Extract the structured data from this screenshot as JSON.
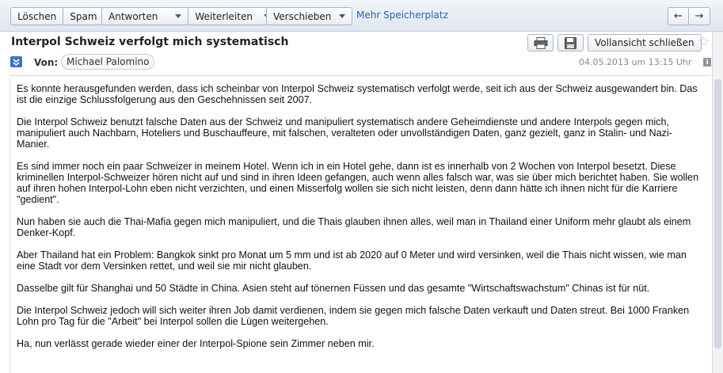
{
  "toolbar": {
    "delete_label": "Löschen",
    "spam_label": "Spam",
    "reply_label": "Antworten",
    "forward_label": "Weiterleiten",
    "move_label": "Verschieben",
    "storage_link": "Mehr Speicherplatz",
    "prev_arrow": "←",
    "next_arrow": "→"
  },
  "message": {
    "subject": "Interpol Schweiz verfolgt mich systematisch",
    "close_full_view_label": "Vollansicht schließen",
    "from_label": "Von:",
    "sender": "Michael Palomino",
    "date": "04.05.2013 um 13:15 Uhr",
    "info_glyph": "i",
    "paragraphs": [
      "Es konnte herausgefunden werden, dass ich scheinbar von Interpol Schweiz systematisch verfolgt werde, seit ich aus der Schweiz ausgewandert bin. Das ist die einzige Schlussfolgerung aus den Geschehnissen seit 2007.",
      "Die Interpol Schweiz benutzt falsche Daten aus der Schweiz und manipuliert systematisch andere Geheimdienste und andere Interpols gegen mich, manipuliert auch Nachbarn, Hoteliers und Buschauffeure, mit falschen, veralteten oder unvollständigen Daten, ganz gezielt, ganz in Stalin- und Nazi-Manier.",
      "Es sind immer noch ein paar Schweizer in meinem Hotel. Wenn ich in ein Hotel gehe, dann ist es innerhalb von 2 Wochen von Interpol besetzt. Diese kriminellen Interpol-Schweizer hören nicht auf und sind in ihren Ideen gefangen, auch wenn alles falsch war, was sie über mich berichtet haben. Sie wollen auf ihren hohen Interpol-Lohn eben nicht verzichten, und einen Misserfolg wollen sie sich nicht leisten, denn dann hätte ich ihnen nicht für die Karriere \"gedient\".",
      "Nun haben sie auch die Thai-Mafia gegen mich manipuliert, und die Thais glauben ihnen alles, weil man in Thailand einer Uniform mehr glaubt als einem Denker-Kopf.",
      "Aber Thailand hat ein Problem: Bangkok sinkt pro Monat um 5 mm und ist ab 2020 auf 0 Meter und wird versinken, weil die Thais nicht wissen, wie man eine Stadt vor dem Versinken rettet, und weil sie mir nicht glauben.",
      "Dasselbe gilt für Shanghai und 50 Städte in China. Asien steht auf tönernen Füssen und das gesamte \"Wirtschaftswachstum\" Chinas ist für nüt.",
      "Die Interpol Schweiz jedoch will sich weiter ihren Job damit verdienen, indem sie gegen mich falsche Daten verkauft und Daten streut. Bei 1000 Franken Lohn pro Tag für die \"Arbeit\" bei Interpol sollen die Lügen weitergehen.",
      "Ha, nun verlässt gerade wieder einer der Interpol-Spione sein Zimmer neben mir."
    ]
  },
  "icons": {
    "print": "print-icon",
    "save": "floppy-disk-icon",
    "star": "star-icon",
    "expand": "chevron-double-down-icon",
    "info": "info-icon"
  },
  "colors": {
    "link": "#2a62b5",
    "expand_icon": "#3a73c6"
  }
}
